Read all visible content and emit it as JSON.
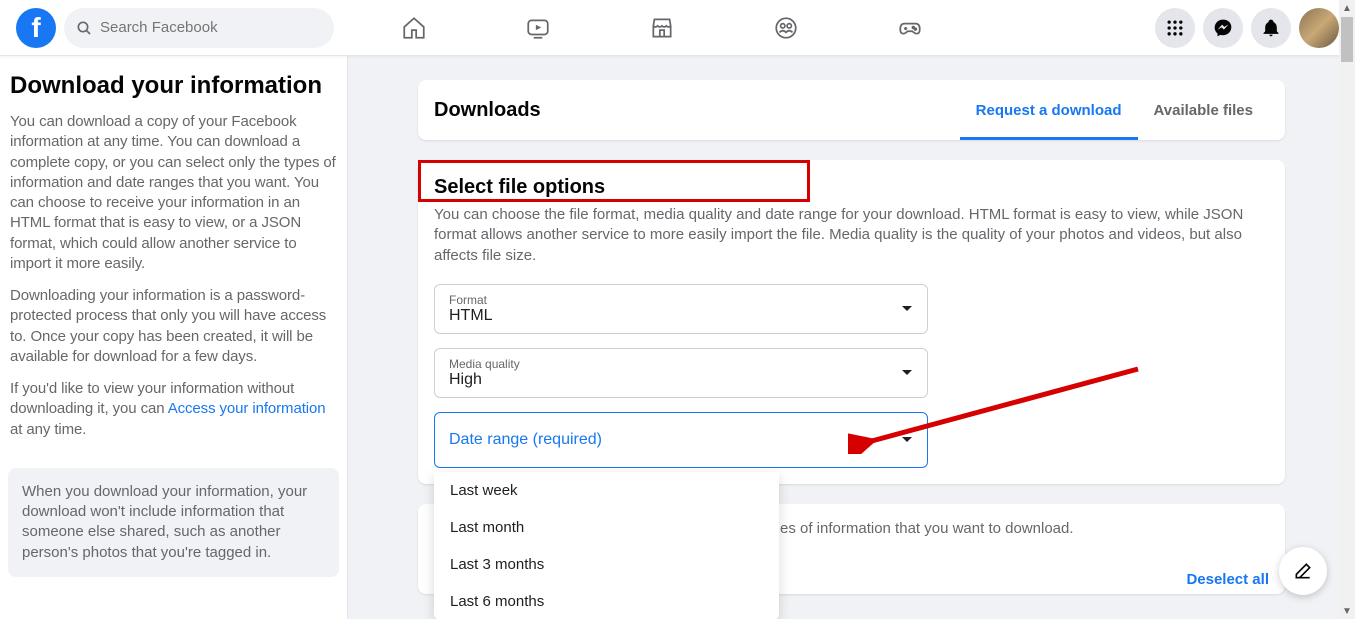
{
  "topbar": {
    "search_placeholder": "Search Facebook"
  },
  "sidebar": {
    "title": "Download your information",
    "p1": "You can download a copy of your Facebook information at any time. You can download a complete copy, or you can select only the types of information and date ranges that you want. You can choose to receive your information in an HTML format that is easy to view, or a JSON format, which could allow another service to import it more easily.",
    "p2": "Downloading your information is a password-protected process that only you will have access to. Once your copy has been created, it will be available for download for a few days.",
    "p3a": "If you'd like to view your information without downloading it, you can ",
    "p3_link": "Access your information",
    "p3b": " at any time.",
    "info_box": "When you download your information, your download won't include information that someone else shared, such as another person's photos that you're tagged in."
  },
  "tabs_card": {
    "title": "Downloads",
    "tab1": "Request a download",
    "tab2": "Available files"
  },
  "options": {
    "section_title": "Select file options",
    "section_desc": "You can choose the file format, media quality and date range for your download. HTML format is easy to view, while JSON format allows another service to more easily import the file. Media quality is the quality of your photos and videos, but also affects file size.",
    "format_label": "Format",
    "format_value": "HTML",
    "quality_label": "Media quality",
    "quality_value": "High",
    "daterange_label": "Date range (required)",
    "dropdown": [
      "Last week",
      "Last month",
      "Last 3 months",
      "Last 6 months"
    ]
  },
  "lower": {
    "desc_fragment": "es of information that you want to download.",
    "deselect": "Deselect all"
  }
}
